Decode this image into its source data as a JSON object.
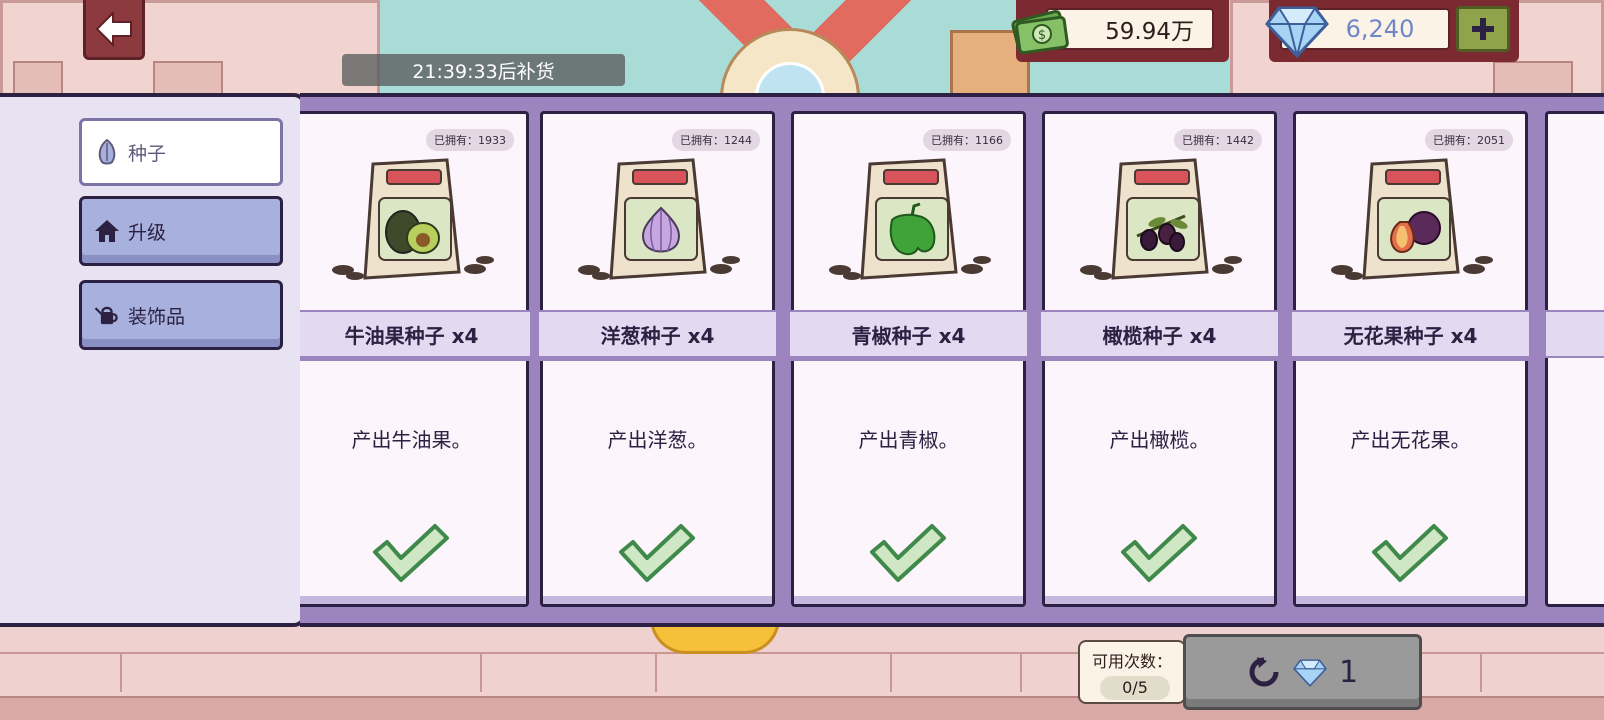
{
  "hud": {
    "restock_timer": "21:39:33后补货",
    "cash_amount": "59.94万",
    "gem_amount": "6,240"
  },
  "tabs": [
    {
      "label": "种子",
      "icon": "seed-icon",
      "active": true
    },
    {
      "label": "升级",
      "icon": "house-icon",
      "active": false
    },
    {
      "label": "装饰品",
      "icon": "watering-can-icon",
      "active": false
    }
  ],
  "cards": [
    {
      "owned": "已拥有：1933",
      "title": "牛油果种子 x4",
      "desc": "产出牛油果。",
      "produce": "avocado"
    },
    {
      "owned": "已拥有：1244",
      "title": "洋葱种子 x4",
      "desc": "产出洋葱。",
      "produce": "onion"
    },
    {
      "owned": "已拥有：1166",
      "title": "青椒种子 x4",
      "desc": "产出青椒。",
      "produce": "green-pepper"
    },
    {
      "owned": "已拥有：1442",
      "title": "橄榄种子 x4",
      "desc": "产出橄榄。",
      "produce": "olive"
    },
    {
      "owned": "已拥有：2051",
      "title": "无花果种子 x4",
      "desc": "产出无花果。",
      "produce": "fig"
    }
  ],
  "refresh": {
    "uses_label": "可用次数：",
    "uses_value": "0/5",
    "cost": "1"
  },
  "colors": {
    "panel_purple": "#9c84bf",
    "outline_dark": "#2c2142",
    "check_green": "#3f8a4a",
    "hud_maroon": "#7a2a30"
  }
}
